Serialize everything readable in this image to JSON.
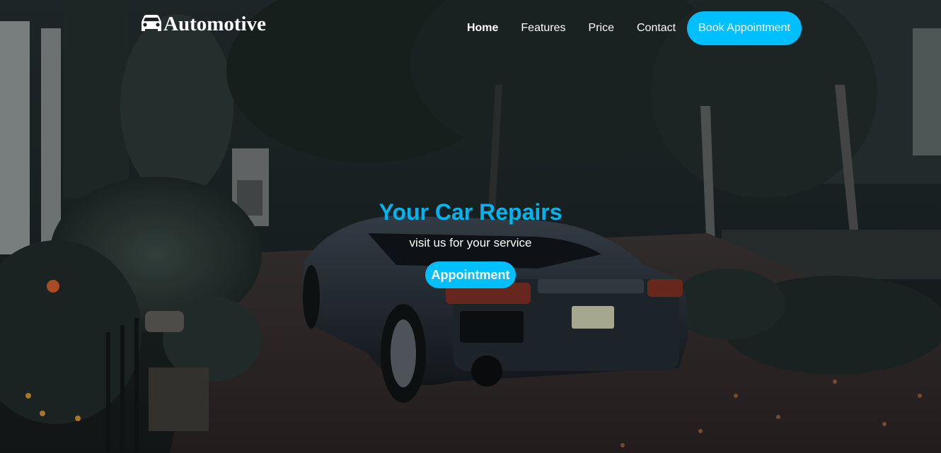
{
  "brand": {
    "name": "Automotive",
    "icon": "car-icon"
  },
  "nav": {
    "links": [
      {
        "label": "Home",
        "active": true
      },
      {
        "label": "Features",
        "active": false
      },
      {
        "label": "Price",
        "active": false
      },
      {
        "label": "Contact",
        "active": false
      }
    ],
    "book_button": "Book Appointment"
  },
  "hero": {
    "title": "Your Car Repairs",
    "subtitle": "visit us for your service",
    "button": "Appointment"
  },
  "colors": {
    "accent": "#00bfff",
    "title": "#00b4f0",
    "text": "#ffffff"
  }
}
